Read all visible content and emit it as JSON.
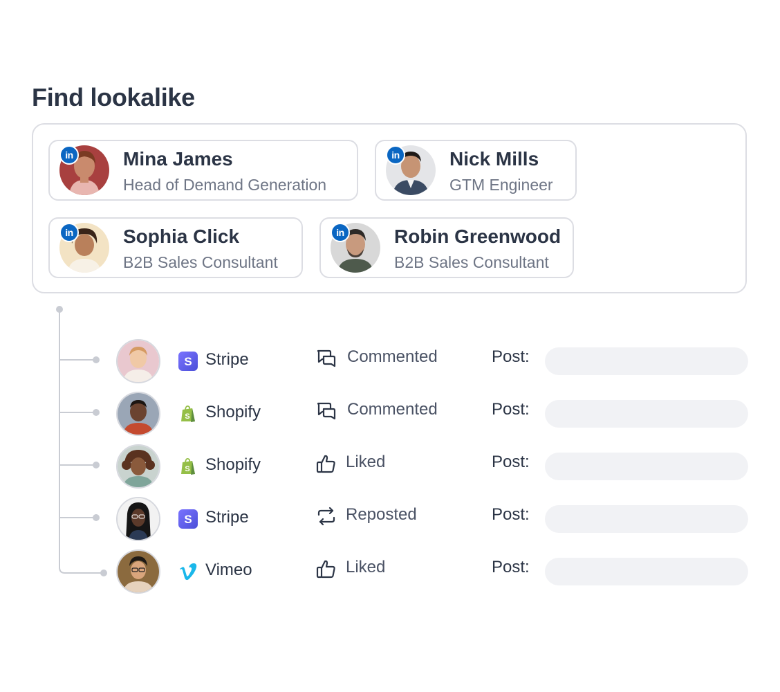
{
  "title": "Find lookalike",
  "lookalikes": [
    {
      "name": "Mina James",
      "role": "Head of Demand Generation",
      "badge": "in",
      "icon": "linkedin-icon"
    },
    {
      "name": "Nick Mills",
      "role": "GTM Engineer",
      "badge": "in",
      "icon": "linkedin-icon"
    },
    {
      "name": "Sophia Click",
      "role": "B2B Sales Consultant",
      "badge": "in",
      "icon": "linkedin-icon"
    },
    {
      "name": "Robin Greenwood",
      "role": "B2B Sales Consultant",
      "badge": "in",
      "icon": "linkedin-icon"
    }
  ],
  "activities": [
    {
      "company": "Stripe",
      "company_icon": "stripe-icon",
      "action": "Commented",
      "action_icon": "comment-icon",
      "post_label": "Post:"
    },
    {
      "company": "Shopify",
      "company_icon": "shopify-icon",
      "action": "Commented",
      "action_icon": "comment-icon",
      "post_label": "Post:"
    },
    {
      "company": "Shopify",
      "company_icon": "shopify-icon",
      "action": "Liked",
      "action_icon": "thumbs-up-icon",
      "post_label": "Post:"
    },
    {
      "company": "Stripe",
      "company_icon": "stripe-icon",
      "action": "Reposted",
      "action_icon": "repost-icon",
      "post_label": "Post:"
    },
    {
      "company": "Vimeo",
      "company_icon": "vimeo-icon",
      "action": "Liked",
      "action_icon": "thumbs-up-icon",
      "post_label": "Post:"
    }
  ],
  "colors": {
    "text": "#2b3445",
    "muted": "#6e7585",
    "border": "#dcdde3",
    "linkedin": "#0a66c2",
    "stripe": "#635bff",
    "shopify": "#95bf47",
    "vimeo": "#1ab7ea"
  }
}
